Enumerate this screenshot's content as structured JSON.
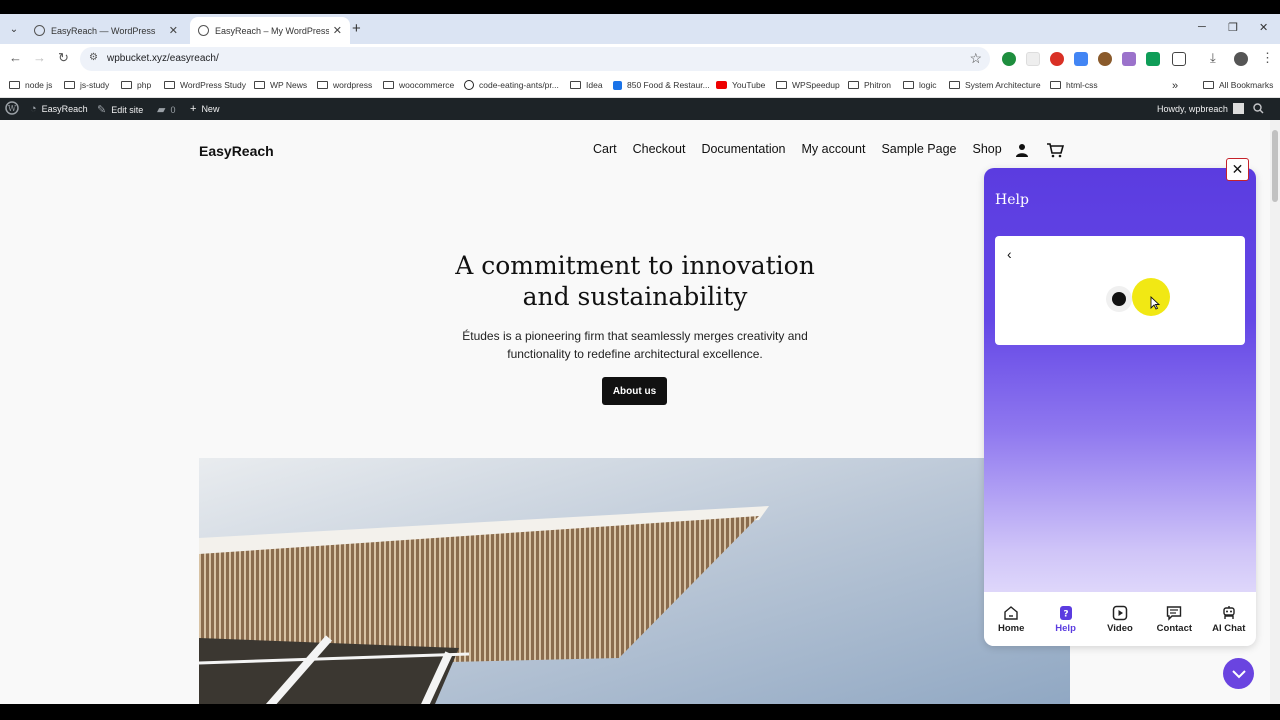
{
  "browser": {
    "tabs": [
      {
        "title": "EasyReach — WordPress",
        "active": false
      },
      {
        "title": "EasyReach – My WordPress Blo",
        "active": true
      }
    ],
    "url": "wpbucket.xyz/easyreach/",
    "bookmarks": [
      {
        "label": "node js",
        "icon": "folder-icon"
      },
      {
        "label": "js-study",
        "icon": "folder-icon"
      },
      {
        "label": "php",
        "icon": "folder-icon"
      },
      {
        "label": "WordPress Study",
        "icon": "folder-icon"
      },
      {
        "label": "WP News",
        "icon": "folder-icon"
      },
      {
        "label": "wordpress",
        "icon": "folder-icon"
      },
      {
        "label": "woocommerce",
        "icon": "folder-icon"
      },
      {
        "label": "code-eating-ants/pr...",
        "icon": "github-icon"
      },
      {
        "label": "Idea",
        "icon": "folder-icon"
      },
      {
        "label": "850 Food & Restaur...",
        "icon": "site-icon"
      },
      {
        "label": "YouTube",
        "icon": "youtube-icon"
      },
      {
        "label": "WPSpeedup",
        "icon": "folder-icon"
      },
      {
        "label": "Phitron",
        "icon": "folder-icon"
      },
      {
        "label": "logic",
        "icon": "folder-icon"
      },
      {
        "label": "System Architecture",
        "icon": "folder-icon"
      },
      {
        "label": "html-css",
        "icon": "folder-icon"
      }
    ],
    "all_bookmarks": "All Bookmarks"
  },
  "admin_bar": {
    "site_name": "EasyReach",
    "edit_site": "Edit site",
    "comments_count": "0",
    "new_label": "New",
    "greeting": "Howdy, wpbreach"
  },
  "site": {
    "title": "EasyReach",
    "menu": [
      "Cart",
      "Checkout",
      "Documentation",
      "My account",
      "Sample Page",
      "Shop"
    ],
    "hero_title_line1": "A commitment to innovation",
    "hero_title_line2": "and sustainability",
    "hero_subtitle": "Études is a pioneering firm that seamlessly merges creativity and functionality to redefine architectural excellence.",
    "cta": "About us"
  },
  "widget": {
    "title": "Help",
    "close_symbol": "✕",
    "nav": [
      {
        "label": "Home",
        "icon": "home-icon",
        "active": false
      },
      {
        "label": "Help",
        "icon": "help-icon",
        "active": true
      },
      {
        "label": "Video",
        "icon": "video-icon",
        "active": false
      },
      {
        "label": "Contact",
        "icon": "contact-icon",
        "active": false
      },
      {
        "label": "AI Chat",
        "icon": "ai-chat-icon",
        "active": false
      }
    ],
    "accent_color": "#5b3ce0"
  }
}
